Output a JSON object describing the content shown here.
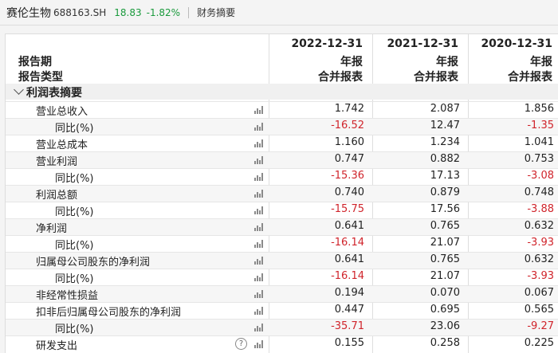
{
  "header": {
    "company": "赛伦生物",
    "code": "688163.SH",
    "price": "18.83",
    "change": "-1.82%",
    "tab": "财务摘要"
  },
  "table": {
    "label_period": "报告期",
    "label_type": "报告类型",
    "columns": [
      {
        "date": "2022-12-31",
        "period": "年报",
        "type": "合并报表"
      },
      {
        "date": "2021-12-31",
        "period": "年报",
        "type": "合并报表"
      },
      {
        "date": "2020-12-31",
        "period": "年报",
        "type": "合并报表"
      }
    ],
    "section_title": "利润表摘要",
    "rows": [
      {
        "label": "营业总收入",
        "level": 1,
        "values": [
          "1.742",
          "2.087",
          "1.856"
        ],
        "neg": [
          false,
          false,
          false
        ]
      },
      {
        "label": "同比(%)",
        "level": 2,
        "values": [
          "-16.52",
          "12.47",
          "-1.35"
        ],
        "neg": [
          true,
          false,
          true
        ]
      },
      {
        "label": "营业总成本",
        "level": 1,
        "values": [
          "1.160",
          "1.234",
          "1.041"
        ],
        "neg": [
          false,
          false,
          false
        ]
      },
      {
        "label": "营业利润",
        "level": 1,
        "values": [
          "0.747",
          "0.882",
          "0.753"
        ],
        "neg": [
          false,
          false,
          false
        ]
      },
      {
        "label": "同比(%)",
        "level": 2,
        "values": [
          "-15.36",
          "17.13",
          "-3.08"
        ],
        "neg": [
          true,
          false,
          true
        ]
      },
      {
        "label": "利润总额",
        "level": 1,
        "values": [
          "0.740",
          "0.879",
          "0.748"
        ],
        "neg": [
          false,
          false,
          false
        ]
      },
      {
        "label": "同比(%)",
        "level": 2,
        "values": [
          "-15.75",
          "17.56",
          "-3.88"
        ],
        "neg": [
          true,
          false,
          true
        ]
      },
      {
        "label": "净利润",
        "level": 1,
        "values": [
          "0.641",
          "0.765",
          "0.632"
        ],
        "neg": [
          false,
          false,
          false
        ]
      },
      {
        "label": "同比(%)",
        "level": 2,
        "values": [
          "-16.14",
          "21.07",
          "-3.93"
        ],
        "neg": [
          true,
          false,
          true
        ]
      },
      {
        "label": "归属母公司股东的净利润",
        "level": 1,
        "values": [
          "0.641",
          "0.765",
          "0.632"
        ],
        "neg": [
          false,
          false,
          false
        ]
      },
      {
        "label": "同比(%)",
        "level": 2,
        "values": [
          "-16.14",
          "21.07",
          "-3.93"
        ],
        "neg": [
          true,
          false,
          true
        ]
      },
      {
        "label": "非经常性损益",
        "level": 1,
        "values": [
          "0.194",
          "0.070",
          "0.067"
        ],
        "neg": [
          false,
          false,
          false
        ]
      },
      {
        "label": "扣非后归属母公司股东的净利润",
        "level": 1,
        "values": [
          "0.447",
          "0.695",
          "0.565"
        ],
        "neg": [
          false,
          false,
          false
        ]
      },
      {
        "label": "同比(%)",
        "level": 2,
        "values": [
          "-35.71",
          "23.06",
          "-9.27"
        ],
        "neg": [
          true,
          false,
          true
        ]
      },
      {
        "label": "研发支出",
        "level": 1,
        "values": [
          "0.155",
          "0.258",
          "0.225"
        ],
        "neg": [
          false,
          false,
          false
        ],
        "help": "?"
      }
    ]
  },
  "colors": {
    "negative": "#d0242b",
    "positive_quote": "#1a9a3c"
  },
  "icons": {
    "row_chart": "bar-chart-icon",
    "help": "help-circle-icon"
  }
}
